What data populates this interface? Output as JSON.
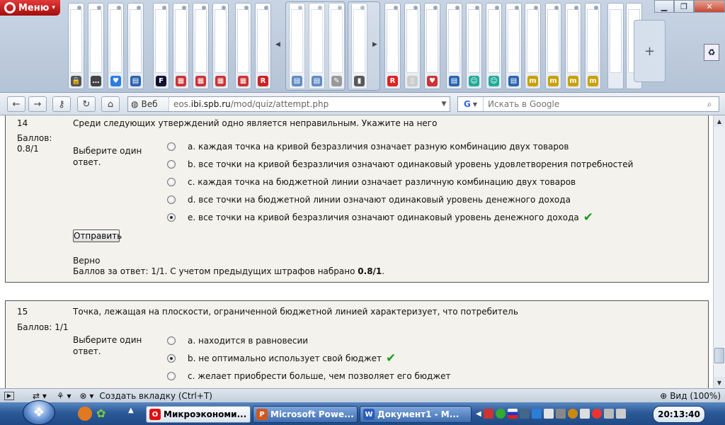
{
  "browser": {
    "menu_label": "Меню",
    "web_label": "Веб",
    "url_host_prefix": "eos.",
    "url_host_bold": "ibi.spb.ru",
    "url_path": "/mod/quiz/attempt.php",
    "search_placeholder": "Искать в Google",
    "search_engine_letter": "G",
    "new_tab_label": "Создать вкладку (Ctrl+T)",
    "zoom_label": "Вид (100%)",
    "tab_icons": [
      "🔒",
      "…",
      "♥",
      "▤",
      "F",
      "▦",
      "▦",
      "▦",
      "▦",
      "R",
      "▤",
      "▤",
      "✎",
      "▮",
      "R",
      "▯",
      "♥",
      "▤",
      "☺",
      "☺",
      "▤",
      "m",
      "m",
      "m",
      "m"
    ]
  },
  "questions": [
    {
      "number": "14",
      "text": "Среди следующих утверждений одно является неправильным. Укажите на него",
      "grade_label": "Баллов:",
      "grade_value": "0.8/1",
      "prompt": "Выберите один ответ.",
      "options": [
        {
          "text": "a. каждая точка на кривой безразличия означает разную комбинацию двух товаров",
          "selected": false,
          "correct": false
        },
        {
          "text": "b. все точки на кривой безразличия означают одинаковый уровень удовлетворения потребностей",
          "selected": false,
          "correct": false
        },
        {
          "text": "c. каждая точка на бюджетной линии означает различную комбинацию двух товаров",
          "selected": false,
          "correct": false
        },
        {
          "text": "d. все точки на бюджетной линии означают одинаковый уровень денежного дохода",
          "selected": false,
          "correct": false
        },
        {
          "text": "e. все точки на кривой безразличия означают одинаковый уровень денежного дохода",
          "selected": true,
          "correct": true
        }
      ],
      "submit_label": "Отправить",
      "feedback_title": "Верно",
      "feedback_text": "Баллов за ответ: 1/1. С учетом предыдущих штрафов набрано ",
      "feedback_total": "0.8/1",
      "feedback_end": "."
    },
    {
      "number": "15",
      "text": "Точка, лежащая на плоскости, ограниченной бюджетной линией характеризует, что потребитель",
      "grade_label": "Баллов: 1/1",
      "prompt": "Выберите один ответ.",
      "options": [
        {
          "text": "a. находится в равновесии",
          "selected": false,
          "correct": false
        },
        {
          "text": "b. не оптимально использует свой бюджет",
          "selected": true,
          "correct": true
        },
        {
          "text": "c. желает приобрести больше, чем позволяет его бюджет",
          "selected": false,
          "correct": false
        }
      ]
    }
  ],
  "taskbar": {
    "items": [
      {
        "label": "Микроэкономи...",
        "active": true,
        "icon_color": "#d11",
        "icon": "O"
      },
      {
        "label": "Microsoft Powe...",
        "active": false,
        "icon_color": "#d2571d",
        "icon": "P"
      },
      {
        "label": "Документ1 - M...",
        "active": false,
        "icon_color": "#2a5cb8",
        "icon": "W"
      }
    ],
    "clock": "20:13:40"
  },
  "colors": {
    "accent": "#c0392b",
    "check": "#1a9a1a",
    "quiz_bg": "#f3f2ec"
  }
}
